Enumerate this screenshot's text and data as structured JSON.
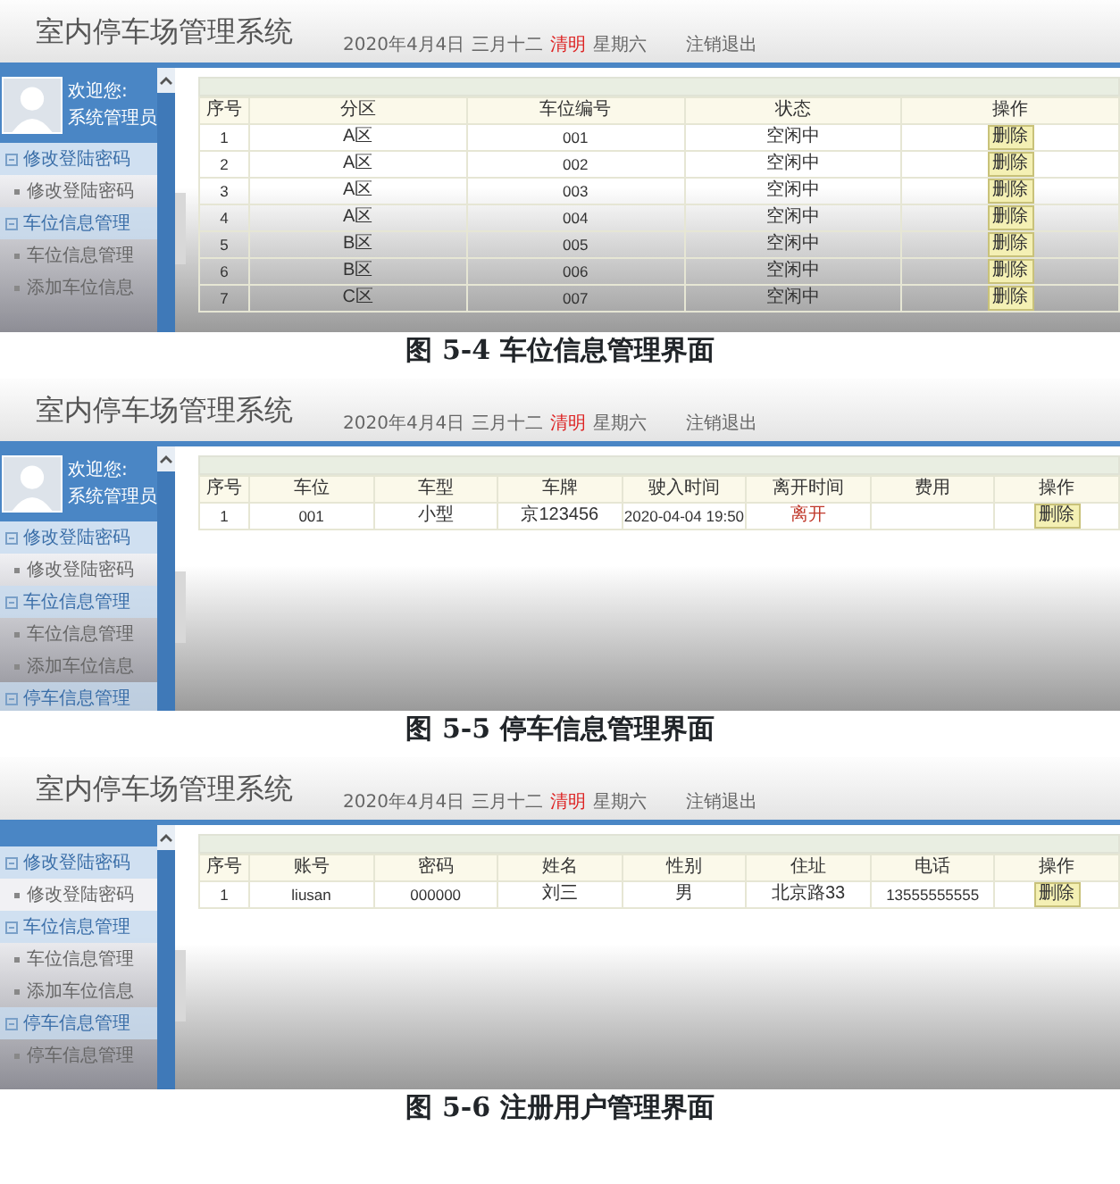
{
  "figures": [
    {
      "screen": {
        "header": {
          "title": "室内停车场管理系统",
          "date": "2020年4月4日",
          "lunar": "三月十二",
          "solar_term": "清明",
          "weekday": "星期六",
          "logout": "注销退出"
        },
        "sidebar": {
          "profile": {
            "greeting": "欢迎您:",
            "role": "系统管理员"
          },
          "groups": [
            {
              "label": "修改登陆密码",
              "children": [
                {
                  "label": "修改登陆密码"
                }
              ]
            },
            {
              "label": "车位信息管理",
              "children": [
                {
                  "label": "车位信息管理"
                },
                {
                  "label": "添加车位信息"
                }
              ]
            }
          ]
        },
        "table": {
          "columns": [
            {
              "label": "序号",
              "kind": "text"
            },
            {
              "label": "分区",
              "kind": "text"
            },
            {
              "label": "车位编号",
              "kind": "text"
            },
            {
              "label": "状态",
              "kind": "text"
            },
            {
              "label": "操作",
              "kind": "action"
            }
          ],
          "rows": [
            [
              "1",
              "A区",
              "001",
              "空闲中",
              "删除"
            ],
            [
              "2",
              "A区",
              "002",
              "空闲中",
              "删除"
            ],
            [
              "3",
              "A区",
              "003",
              "空闲中",
              "删除"
            ],
            [
              "4",
              "A区",
              "004",
              "空闲中",
              "删除"
            ],
            [
              "5",
              "B区",
              "005",
              "空闲中",
              "删除"
            ],
            [
              "6",
              "B区",
              "006",
              "空闲中",
              "删除"
            ],
            [
              "7",
              "C区",
              "007",
              "空闲中",
              "删除"
            ]
          ]
        }
      },
      "caption": "图 5-4 车位信息管理界面"
    },
    {
      "screen": {
        "header": {
          "title": "室内停车场管理系统",
          "date": "2020年4月4日",
          "lunar": "三月十二",
          "solar_term": "清明",
          "weekday": "星期六",
          "logout": "注销退出"
        },
        "sidebar": {
          "profile": {
            "greeting": "欢迎您:",
            "role": "系统管理员"
          },
          "groups": [
            {
              "label": "修改登陆密码",
              "children": [
                {
                  "label": "修改登陆密码"
                }
              ]
            },
            {
              "label": "车位信息管理",
              "children": [
                {
                  "label": "车位信息管理"
                },
                {
                  "label": "添加车位信息"
                }
              ]
            },
            {
              "label": "停车信息管理"
            }
          ]
        },
        "table": {
          "columns": [
            {
              "label": "序号",
              "kind": "text"
            },
            {
              "label": "车位",
              "kind": "text"
            },
            {
              "label": "车型",
              "kind": "text"
            },
            {
              "label": "车牌",
              "kind": "text"
            },
            {
              "label": "驶入时间",
              "kind": "text"
            },
            {
              "label": "离开时间",
              "kind": "link"
            },
            {
              "label": "费用",
              "kind": "text"
            },
            {
              "label": "操作",
              "kind": "action"
            }
          ],
          "rows": [
            [
              "1",
              "001",
              "小型",
              "京123456",
              "2020-04-04 19:50",
              "离开",
              "",
              "删除"
            ]
          ]
        }
      },
      "caption": "图 5-5 停车信息管理界面"
    },
    {
      "screen": {
        "header": {
          "title": "室内停车场管理系统",
          "date": "2020年4月4日",
          "lunar": "三月十二",
          "solar_term": "清明",
          "weekday": "星期六",
          "logout": "注销退出"
        },
        "sidebar": {
          "groups": [
            {
              "label": "修改登陆密码",
              "children": [
                {
                  "label": "修改登陆密码"
                }
              ]
            },
            {
              "label": "车位信息管理",
              "children": [
                {
                  "label": "车位信息管理"
                },
                {
                  "label": "添加车位信息"
                }
              ]
            },
            {
              "label": "停车信息管理",
              "children": [
                {
                  "label": "停车信息管理"
                }
              ]
            }
          ]
        },
        "table": {
          "columns": [
            {
              "label": "序号",
              "kind": "text"
            },
            {
              "label": "账号",
              "kind": "text"
            },
            {
              "label": "密码",
              "kind": "text"
            },
            {
              "label": "姓名",
              "kind": "text"
            },
            {
              "label": "性别",
              "kind": "text"
            },
            {
              "label": "住址",
              "kind": "text"
            },
            {
              "label": "电话",
              "kind": "text"
            },
            {
              "label": "操作",
              "kind": "action"
            }
          ],
          "rows": [
            [
              "1",
              "liusan",
              "000000",
              "刘三",
              "男",
              "北京路33",
              "13555555555",
              "删除"
            ]
          ]
        }
      },
      "caption": "图 5-6 注册用户管理界面"
    }
  ]
}
